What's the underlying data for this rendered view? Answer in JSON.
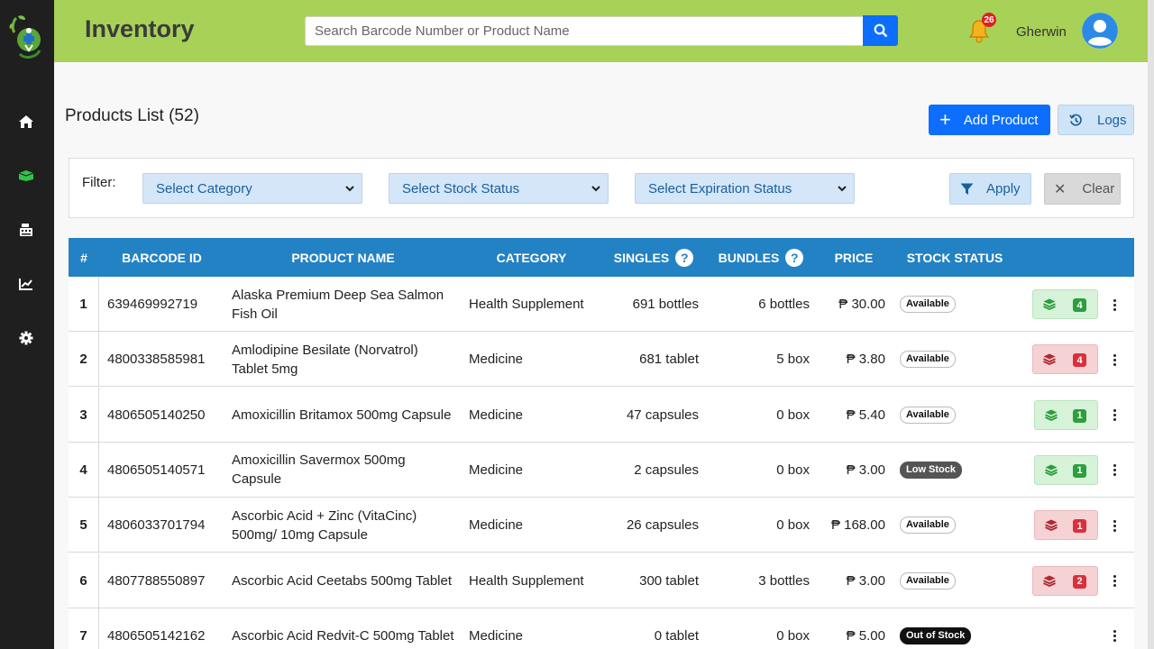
{
  "header": {
    "title": "Inventory",
    "search_placeholder": "Search Barcode Number or Product Name",
    "notification_count": "26",
    "username": "Gherwin"
  },
  "sidebar": {
    "items": [
      {
        "icon": "home-icon"
      },
      {
        "icon": "box-icon",
        "active": true
      },
      {
        "icon": "cash-register-icon"
      },
      {
        "icon": "chart-line-icon"
      },
      {
        "icon": "gear-icon"
      }
    ]
  },
  "main": {
    "title": "Products List (52)",
    "add_label": "Add Product",
    "logs_label": "Logs"
  },
  "filter": {
    "label": "Filter:",
    "category_placeholder": "Select Category",
    "stock_placeholder": "Select Stock Status",
    "expiration_placeholder": "Select Expiration Status",
    "apply_label": "Apply",
    "clear_label": "Clear"
  },
  "table": {
    "columns": [
      "#",
      "BARCODE ID",
      "PRODUCT NAME",
      "CATEGORY",
      "SINGLES",
      "BUNDLES",
      "PRICE",
      "STOCK STATUS"
    ],
    "help_mark": "?",
    "rows": [
      {
        "num": "1",
        "barcode": "639469992719",
        "name": "Alaska Premium Deep Sea Salmon Fish Oil",
        "category": "Health Supplement",
        "singles": "691 bottles",
        "bundles": "6 bottles",
        "price": "₱ 30.00",
        "status": "Available",
        "status_type": "available",
        "batch_color": "green",
        "batch_count": "4"
      },
      {
        "num": "2",
        "barcode": "4800338585981",
        "name": "Amlodipine Besilate (Norvatrol) Tablet 5mg",
        "category": "Medicine",
        "singles": "681 tablet",
        "bundles": "5 box",
        "price": "₱ 3.80",
        "status": "Available",
        "status_type": "available",
        "batch_color": "red",
        "batch_count": "4"
      },
      {
        "num": "3",
        "barcode": "4806505140250",
        "name": "Amoxicillin Britamox 500mg Capsule",
        "category": "Medicine",
        "singles": "47 capsules",
        "bundles": "0 box",
        "price": "₱ 5.40",
        "status": "Available",
        "status_type": "available",
        "batch_color": "green",
        "batch_count": "1"
      },
      {
        "num": "4",
        "barcode": "4806505140571",
        "name": "Amoxicillin Savermox 500mg Capsule",
        "category": "Medicine",
        "singles": "2 capsules",
        "bundles": "0 box",
        "price": "₱ 3.00",
        "status": "Low Stock",
        "status_type": "low",
        "batch_color": "green",
        "batch_count": "1"
      },
      {
        "num": "5",
        "barcode": "4806033701794",
        "name": "Ascorbic Acid + Zinc (VitaCinc) 500mg/ 10mg Capsule",
        "category": "Medicine",
        "singles": "26 capsules",
        "bundles": "0 box",
        "price": "₱ 168.00",
        "status": "Available",
        "status_type": "available",
        "batch_color": "red",
        "batch_count": "1"
      },
      {
        "num": "6",
        "barcode": "4807788550897",
        "name": "Ascorbic Acid Ceetabs 500mg Tablet",
        "category": "Health Supplement",
        "singles": "300 tablet",
        "bundles": "3 bottles",
        "price": "₱ 3.00",
        "status": "Available",
        "status_type": "available",
        "batch_color": "red",
        "batch_count": "2"
      },
      {
        "num": "7",
        "barcode": "4806505142162",
        "name": "Ascorbic Acid Redvit-C 500mg Tablet",
        "category": "Medicine",
        "singles": "0 tablet",
        "bundles": "0 box",
        "price": "₱ 5.00",
        "status": "Out of Stock",
        "status_type": "out",
        "batch_color": "",
        "batch_count": ""
      }
    ]
  },
  "colors": {
    "header_bg": "#a8d158",
    "sidebar_bg": "#1f1f1f",
    "primary": "#0d6efd",
    "table_header": "#2382c4"
  }
}
